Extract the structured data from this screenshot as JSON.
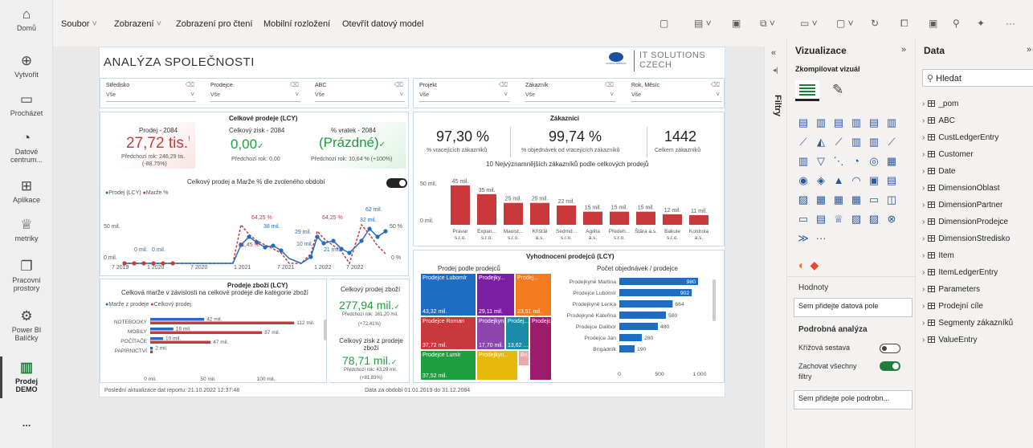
{
  "nav": {
    "items": [
      {
        "label": "Domů",
        "icon": "home-icon"
      },
      {
        "label": "Vytvořit",
        "icon": "plus-circle-icon"
      },
      {
        "label": "Procházet",
        "icon": "folder-icon"
      },
      {
        "label": "Datové centrum...",
        "icon": "data-hub-icon"
      },
      {
        "label": "Aplikace",
        "icon": "apps-icon"
      },
      {
        "label": "metriky",
        "icon": "trophy-icon"
      },
      {
        "label": "Pracovní prostory",
        "icon": "workspaces-icon"
      },
      {
        "label": "Power BI Balíčky",
        "icon": "packages-icon"
      },
      {
        "label": "Prodej DEMO",
        "icon": "report-icon"
      }
    ],
    "more": "..."
  },
  "menu": {
    "file": "Soubor",
    "view": "Zobrazení",
    "reading": "Zobrazení pro čtení",
    "mobile": "Mobilní rozložení",
    "open_model": "Otevřít datový model"
  },
  "report": {
    "title": "ANALÝZA SPOLEČNOSTI",
    "logo_small": "KONICA MINOLTA",
    "logo_line1": "IT SOLUTIONS",
    "logo_line2": "CZECH",
    "slicers": [
      {
        "label": "Středisko",
        "value": "Vše"
      },
      {
        "label": "Prodejce",
        "value": "Vše"
      },
      {
        "label": "ABC",
        "value": "Vše"
      },
      {
        "label": "Projekt",
        "value": "Vše"
      },
      {
        "label": "Zákazník",
        "value": "Vše"
      },
      {
        "label": "Rok, Měsíc",
        "value": "Vše"
      }
    ],
    "sales": {
      "title": "Celkové prodeje (LCY)",
      "kpi1_label": "Prodej - 2084",
      "kpi1_value": "27,72 tis.",
      "kpi1_mark": "!",
      "kpi1_sub": "Předchozí rok: 246,29 tis.",
      "kpi1_sub2": "(-88,75%)",
      "kpi2_label": "Celkový zisk - 2084",
      "kpi2_value": "0,00",
      "kpi2_sub": "Předchozí rok: 0,00",
      "kpi3_label": "% vratek - 2084",
      "kpi3_value": "(Prázdné)",
      "kpi3_sub": "Předchozí rok: 10,64 % (+100%)",
      "chart_title": "Celkový prodej a Marže % dle zvoleného období",
      "legend1": "Prodej (LCY)",
      "legend2": "Marže %",
      "ytick_50": "50 mil.",
      "ytick_0": "0 mil.",
      "ytick_r50": "50 %",
      "ytick_r0": "0 %",
      "xticks": [
        "7 2019",
        "1 2020",
        "7 2020",
        "1 2021",
        "7 2021",
        "1 2022",
        "7 2022"
      ],
      "labels": [
        "0 mil.",
        "0 mil.",
        "64,25 %",
        "38 mil.",
        "29 mil.",
        "64,25 %",
        "62 mil.",
        "32 mil.",
        "21 mil.",
        "21,45 %",
        "10 mil."
      ]
    },
    "customers": {
      "title": "Zákazníci",
      "kpi1_value": "97,30 %",
      "kpi1_label": "% vracejících zákazníků",
      "kpi2_value": "99,74 %",
      "kpi2_label": "% objednávek od vracejících zákazníků",
      "kpi3_value": "1442",
      "kpi3_label": "Celkem zákazníků",
      "chart_title": "10 Nejvýznamnějších zákazníků podle celkových prodejů",
      "ytick_50": "50 mil.",
      "ytick_0": "0 mil."
    },
    "products": {
      "title": "Prodeje zboží (LCY)",
      "subtitle": "Celková marže v závislosti na celkové prodeje dle kategorie zboží",
      "legend1": "Marže z prodeje",
      "legend2": "Celkový prodej",
      "xticks": [
        "0 mil.",
        "50 mil.",
        "100 mil."
      ],
      "total_label": "Celkový prodej zboží",
      "total_value": "277,94 mil.",
      "total_sub": "Předchozí rok: 161,20 mil.",
      "total_sub2": "(+72,41%)",
      "profit_label": "Celkový zisk z prodeje zboží",
      "profit_value": "78,71 mil.",
      "profit_sub": "Předchozí rok: 43,29 mil.",
      "profit_sub2": "(+81,83%)"
    },
    "projects": {
      "title": "Vyhodnocení prodejců (LCY)",
      "treemap_title": "Prodej podle prodejců",
      "bar_title": "Počet objednávek / prodejce",
      "xticks": [
        "0",
        "500",
        "1 000"
      ]
    },
    "footer_left": "Poslední aktualizace dat reportu: 21.10.2022 12:37:48",
    "footer_right": "Data za období 01.01.2019 do 31.12.2084"
  },
  "filters_label": "Filtry",
  "viz": {
    "title": "Vizualizace",
    "build": "Zkompilovat vizuál",
    "values_label": "Hodnoty",
    "values_placeholder": "Sem přidejte datová pole",
    "drill_title": "Podrobná analýza",
    "cross_report": "Křížová sestava",
    "keep_filters": "Zachovat všechny filtry",
    "drill_placeholder": "Sem přidejte pole podrobn..."
  },
  "data": {
    "title": "Data",
    "search_placeholder": "Hledat",
    "fields": [
      "_pom",
      "ABC",
      "CustLedgerEntry",
      "Customer",
      "Date",
      "DimensionOblast",
      "DimensionPartner",
      "DimensionProdejce",
      "DimensionStredisko",
      "Item",
      "ItemLedgerEntry",
      "Parameters",
      "Prodejní cíle",
      "Segmenty zákazníků",
      "ValueEntry"
    ]
  },
  "colors": {
    "accent_red": "#c9393c",
    "accent_green": "#1e9e3e",
    "series_blue": "#1f6dc2",
    "treemap_blue": "#1f6dc2"
  },
  "chart_data": [
    {
      "type": "line",
      "title": "Celkový prodej a Marže % dle zvoleného období",
      "series": [
        {
          "name": "Prodej (LCY)"
        },
        {
          "name": "Marže %"
        }
      ],
      "data_labels": [
        "0 mil.",
        "0 mil.",
        "38 mil.",
        "29 mil.",
        "62 mil.",
        "32 mil.",
        "21 mil.",
        "10 mil.",
        "64,25 %",
        "64,25 %",
        "21,45 %"
      ],
      "x_ticks": [
        "7 2019",
        "1 2020",
        "7 2020",
        "1 2021",
        "7 2021",
        "1 2022",
        "7 2022"
      ]
    },
    {
      "type": "bar",
      "title": "10 Nejvýznamnějších zákazníků podle celkových prodejů",
      "categories": [
        "Pravar",
        "Expan...",
        "Maoist...",
        "Křišťál",
        "Sedmd...",
        "Agilita",
        "Předeh...",
        "Štára a.s.",
        "Bakule",
        "Kontrola"
      ],
      "category_sub": [
        "s.r.o.",
        "s.r.o.",
        "s.r.o.",
        "a.s.",
        "s.r.o.",
        "a.s.",
        "s.r.o.",
        "",
        "s.r.o.",
        "a.s."
      ],
      "values": [
        45,
        35,
        25,
        25,
        22,
        15,
        15,
        15,
        12,
        11
      ],
      "labels": [
        "45 mil.",
        "35 mil.",
        "25 mil.",
        "25 mil.",
        "22 mil.",
        "15 mil.",
        "15 mil.",
        "15 mil.",
        "12 mil.",
        "11 mil."
      ],
      "ylim": [
        0,
        55
      ]
    },
    {
      "type": "bar",
      "title": "Prodeje zboží (LCY)",
      "categories": [
        "NOTEBOOKY",
        "MOBILY",
        "POČÍTAČE",
        "PAPÍRNICTVÍ"
      ],
      "series": [
        {
          "name": "Marže z prodeje",
          "values": [
            42,
            18,
            10,
            2
          ],
          "labels": [
            "42 mil.",
            "18 mil.",
            "10 mil.",
            "2 mil."
          ]
        },
        {
          "name": "Celkový prodej",
          "values": [
            112,
            87,
            47,
            2
          ],
          "labels": [
            "112 mil.",
            "87 mil.",
            "47 mil.",
            ""
          ]
        }
      ],
      "xlim": [
        0,
        125
      ]
    },
    {
      "type": "heatmap",
      "title": "Prodej podle prodejců",
      "cells": [
        {
          "name": "Prodejce Lubomír",
          "value": "43,32 mil.",
          "color": "#1f6dc2"
        },
        {
          "name": "Prodejky...",
          "value": "29,11 mil.",
          "color": "#7b1fa2"
        },
        {
          "name": "Prodej...",
          "value": "23,51 mil.",
          "color": "#f47b20"
        },
        {
          "name": "Prodejce Roman",
          "value": "37,72 mil.",
          "color": "#c9393c"
        },
        {
          "name": "Prodejkyn...",
          "value": "17,70 mil.",
          "color": "#8e44ad"
        },
        {
          "name": "Prodej...",
          "value": "13,62 ...",
          "color": "#1b8ca8"
        },
        {
          "name": "Prodejce Lumír",
          "value": "37,52 mil.",
          "color": "#1e9e3e"
        },
        {
          "name": "Prodejkyn...",
          "value": "",
          "color": "#e6b80b"
        },
        {
          "name": "Bri...",
          "value": "",
          "color": "#e9a8a8"
        },
        {
          "name": "Prodejce ...",
          "value": "",
          "color": "#9b1c6a"
        }
      ]
    },
    {
      "type": "bar",
      "title": "Počet objednávek / prodejce",
      "categories": [
        "Prodejkyně Martina",
        "Prodejce Lubomír",
        "Prodejkyně Lenka",
        "Prodejkyně Kateřina",
        "Prodejce Dalibor",
        "Prodejce Jan",
        "Brigádník"
      ],
      "values": [
        980,
        902,
        664,
        580,
        480,
        280,
        190
      ],
      "xlim": [
        0,
        1100
      ]
    }
  ]
}
